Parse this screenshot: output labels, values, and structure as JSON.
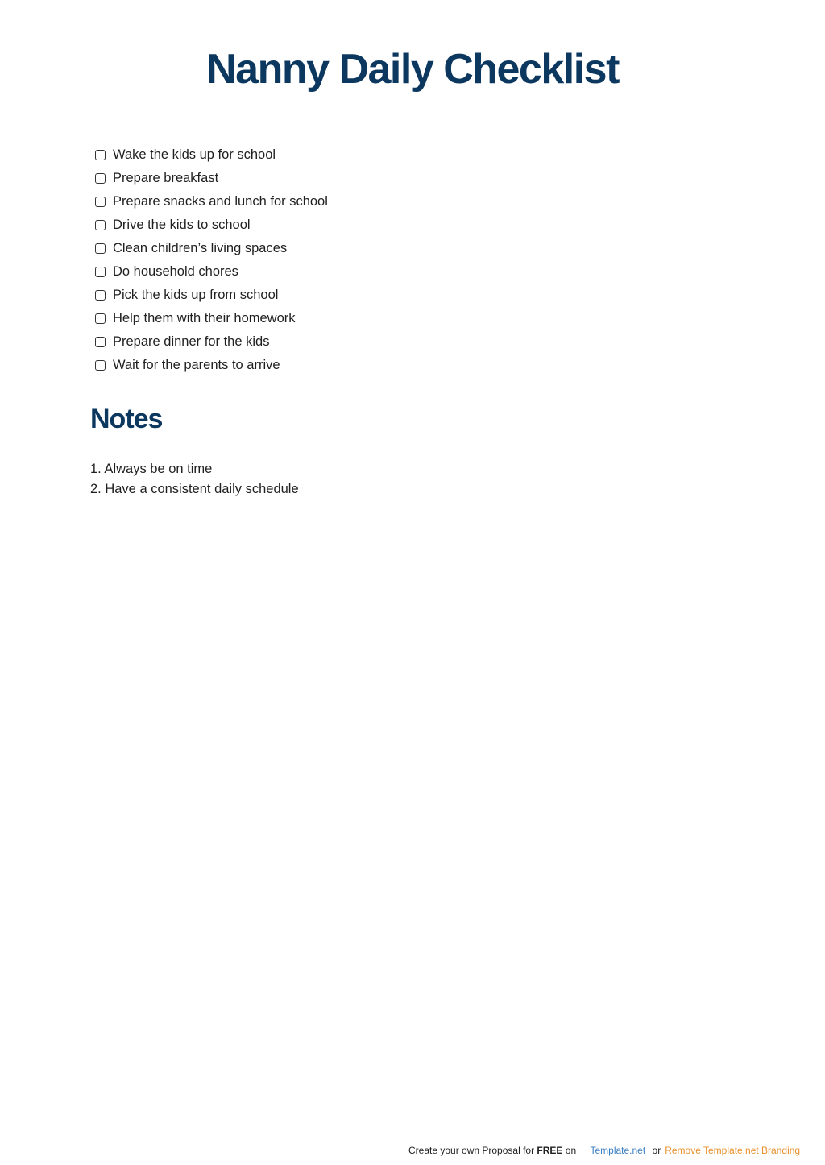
{
  "document": {
    "title": "Nanny Daily Checklist",
    "checklist": [
      {
        "label": "Wake the kids up for school",
        "checked": false
      },
      {
        "label": "Prepare breakfast",
        "checked": false
      },
      {
        "label": "Prepare snacks and lunch for school",
        "checked": false
      },
      {
        "label": "Drive the kids to school",
        "checked": false
      },
      {
        "label": "Clean children’s living spaces",
        "checked": false
      },
      {
        "label": "Do household chores",
        "checked": false
      },
      {
        "label": "Pick the kids up from school",
        "checked": false
      },
      {
        "label": "Help them with their homework",
        "checked": false
      },
      {
        "label": "Prepare dinner for the kids",
        "checked": false
      },
      {
        "label": "Wait for the parents to arrive",
        "checked": false
      }
    ],
    "notes_heading": "Notes",
    "notes": [
      "1. Always be on time",
      "2. Have a consistent daily schedule"
    ]
  },
  "footer": {
    "prefix": "Create your own Proposal for ",
    "free": "FREE",
    "on": " on",
    "link_label": "Template.net",
    "or": "or",
    "remove_label": "Remove Template.net Branding"
  },
  "colors": {
    "heading": "#0c375f",
    "link": "#3a7ec2",
    "remove_link": "#e8912d"
  }
}
